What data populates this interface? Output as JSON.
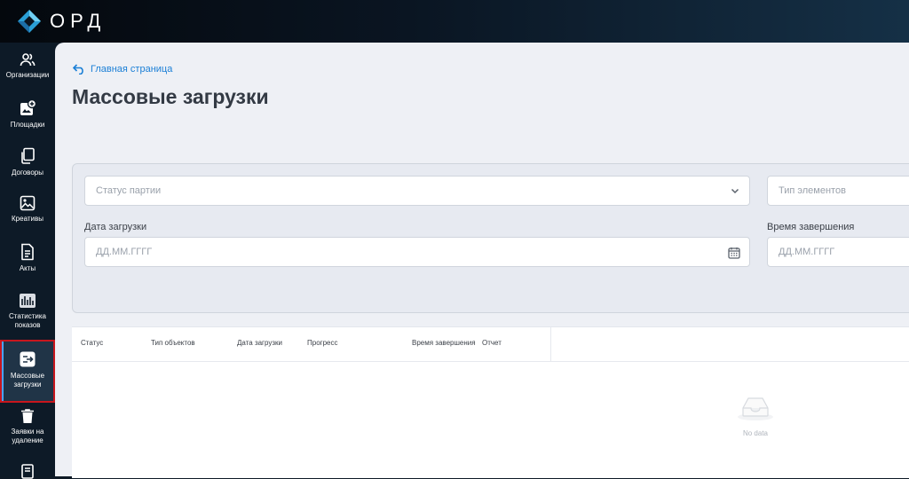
{
  "app": {
    "logo_text": "ОРД"
  },
  "sidebar": {
    "items": [
      {
        "label": "Организации",
        "icon": "users-icon"
      },
      {
        "label": "Площадки",
        "icon": "platform-add-icon"
      },
      {
        "label": "Договоры",
        "icon": "documents-copy-icon"
      },
      {
        "label": "Креативы",
        "icon": "image-icon"
      },
      {
        "label": "Акты",
        "icon": "document-icon"
      },
      {
        "label": "Статистика показов",
        "icon": "stats-icon"
      },
      {
        "label": "Массовые загрузки",
        "icon": "bulk-upload-icon",
        "active": true
      },
      {
        "label": "Заявки на удаление",
        "icon": "trash-icon"
      }
    ]
  },
  "breadcrumb": {
    "label": "Главная страница"
  },
  "page": {
    "title": "Массовые загрузки"
  },
  "filters": {
    "status": {
      "placeholder": "Статус партии"
    },
    "element_type": {
      "placeholder": "Тип элементов"
    },
    "upload_date": {
      "label": "Дата загрузки",
      "placeholder": "ДД.ММ.ГГГГ"
    },
    "finish_time": {
      "label": "Время завершения",
      "placeholder": "ДД.ММ.ГГГГ"
    }
  },
  "table": {
    "columns": [
      "Статус",
      "Тип объектов",
      "Дата загрузки",
      "Прогресс",
      "Время завершения",
      "Отчет"
    ],
    "empty_text": "No data"
  },
  "colors": {
    "accent": "#1b7fd6",
    "highlight": "#c8161d",
    "sidebar": "#0d1a27"
  }
}
